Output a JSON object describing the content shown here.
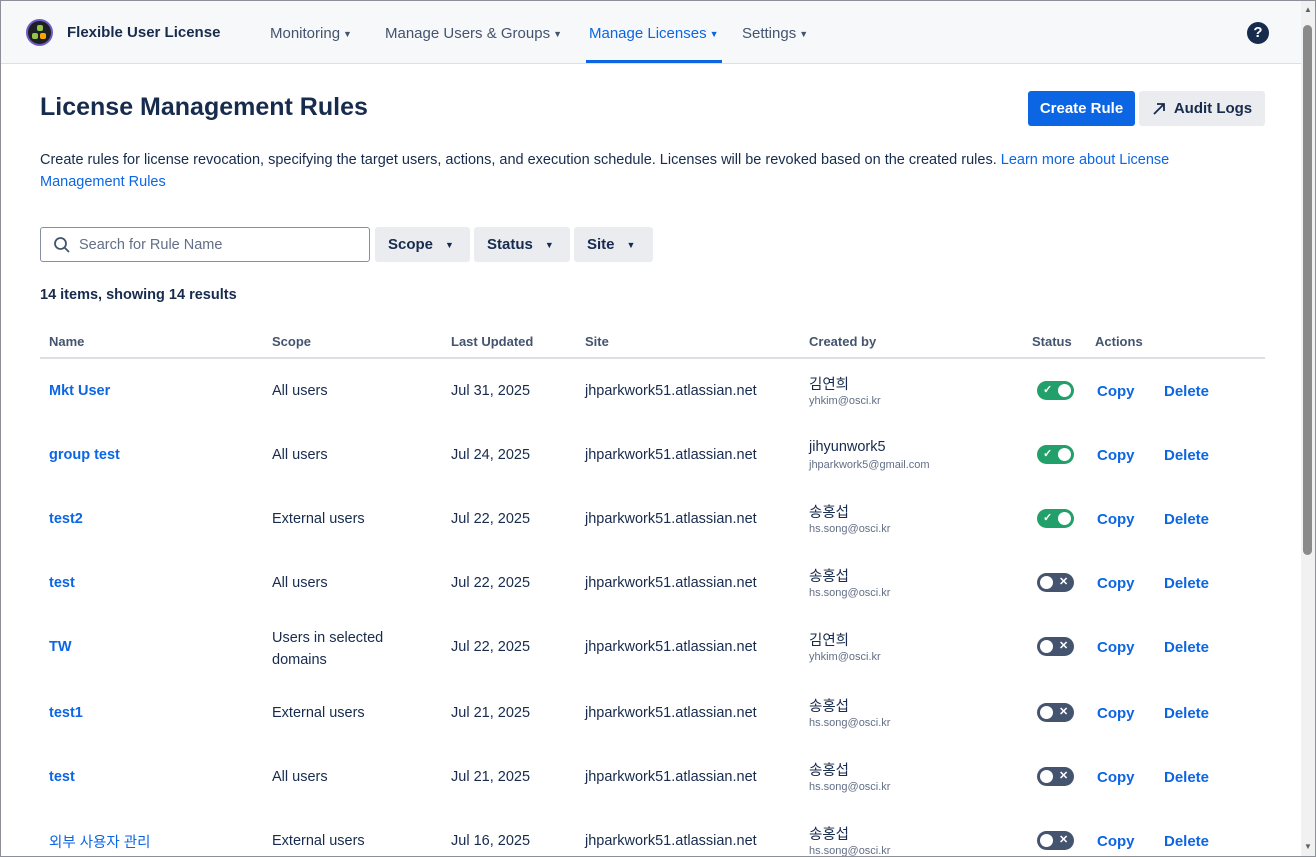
{
  "app": {
    "name": "Flexible User License"
  },
  "nav": {
    "items": [
      {
        "label": "Monitoring"
      },
      {
        "label": "Manage Users & Groups"
      },
      {
        "label": "Manage Licenses"
      },
      {
        "label": "Settings"
      }
    ],
    "active_index": 2,
    "help_glyph": "?"
  },
  "page": {
    "title": "License Management Rules",
    "create_button": "Create Rule",
    "audit_button": "Audit Logs",
    "description": "Create rules for license revocation, specifying the target users, actions, and execution schedule. Licenses will be revoked based on the created rules.",
    "learn_more": "Learn more about License Management Rules"
  },
  "filters": {
    "search_placeholder": "Search for Rule Name",
    "scope": "Scope",
    "status": "Status",
    "site": "Site"
  },
  "result_count": "14 items, showing 14 results",
  "table": {
    "columns": [
      "Name",
      "Scope",
      "Last Updated",
      "Site",
      "Created by",
      "Status",
      "Actions"
    ],
    "copy_label": "Copy",
    "delete_label": "Delete",
    "rows": [
      {
        "name": "Mkt User",
        "scope": "All users",
        "updated": "Jul 31, 2025",
        "site": "jhparkwork51.atlassian.net",
        "creator": "김연희",
        "email": "yhkim@osci.kr",
        "status": "on"
      },
      {
        "name": "group test",
        "scope": "All users",
        "updated": "Jul 24, 2025",
        "site": "jhparkwork51.atlassian.net",
        "creator": "jihyunwork5",
        "email": "jhparkwork5@gmail.com",
        "status": "on"
      },
      {
        "name": "test2",
        "scope": "External users",
        "updated": "Jul 22, 2025",
        "site": "jhparkwork51.atlassian.net",
        "creator": "송홍섭",
        "email": "hs.song@osci.kr",
        "status": "on"
      },
      {
        "name": "test",
        "scope": "All users",
        "updated": "Jul 22, 2025",
        "site": "jhparkwork51.atlassian.net",
        "creator": "송홍섭",
        "email": "hs.song@osci.kr",
        "status": "off"
      },
      {
        "name": "TW",
        "scope": "Users in selected domains",
        "updated": "Jul 22, 2025",
        "site": "jhparkwork51.atlassian.net",
        "creator": "김연희",
        "email": "yhkim@osci.kr",
        "status": "off"
      },
      {
        "name": "test1",
        "scope": "External users",
        "updated": "Jul 21, 2025",
        "site": "jhparkwork51.atlassian.net",
        "creator": "송홍섭",
        "email": "hs.song@osci.kr",
        "status": "off"
      },
      {
        "name": "test",
        "scope": "All users",
        "updated": "Jul 21, 2025",
        "site": "jhparkwork51.atlassian.net",
        "creator": "송홍섭",
        "email": "hs.song@osci.kr",
        "status": "off"
      },
      {
        "name": "외부 사용자 관리",
        "scope": "External users",
        "updated": "Jul 16, 2025",
        "site": "jhparkwork51.atlassian.net",
        "creator": "송홍섭",
        "email": "hs.song@osci.kr",
        "status": "off"
      }
    ]
  },
  "colors": {
    "accent": "#0C66E4",
    "toggle_on": "#22A06B",
    "toggle_off": "#44546F",
    "text": "#172B4D"
  }
}
